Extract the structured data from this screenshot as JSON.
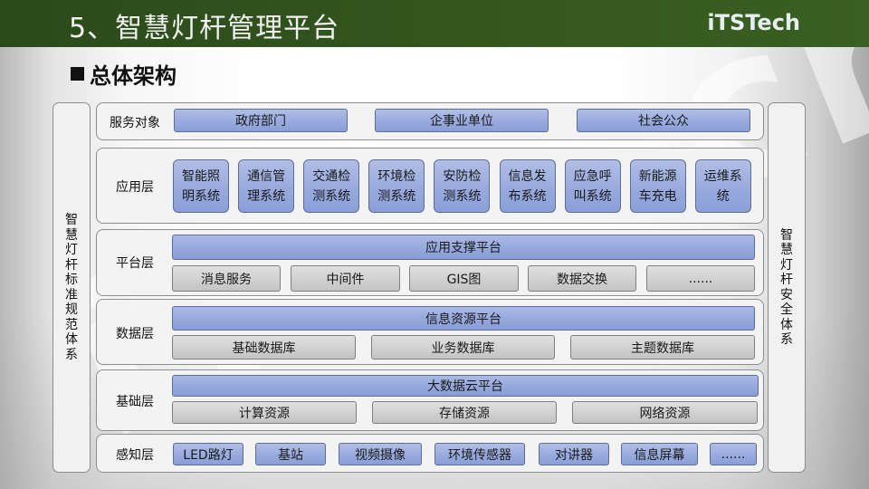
{
  "header": {
    "title": "5、智慧灯杆管理平台",
    "logo": "iTSTech",
    "bar_color": "#33561e"
  },
  "section": {
    "title": "总体架构"
  },
  "watermark": "iTSTech",
  "side_left": {
    "label": "智慧灯杆标准规范体系"
  },
  "side_right": {
    "label": "智慧灯杆安全体系"
  },
  "layers": {
    "service": {
      "label": "服务对象",
      "items": [
        "政府部门",
        "企事业单位",
        "社会公众"
      ]
    },
    "application": {
      "label": "应用层",
      "items": [
        "智能照明系统",
        "通信管理系统",
        "交通检测系统",
        "环境检测系统",
        "安防检测系统",
        "信息发布系统",
        "应急呼叫系统",
        "新能源车充电",
        "运维系统"
      ],
      "lines": [
        [
          "智能照",
          "明系统"
        ],
        [
          "通信管",
          "理系统"
        ],
        [
          "交通检",
          "测系统"
        ],
        [
          "环境检",
          "测系统"
        ],
        [
          "安防检",
          "测系统"
        ],
        [
          "信息发",
          "布系统"
        ],
        [
          "应急呼",
          "叫系统"
        ],
        [
          "新能源",
          "车充电"
        ],
        [
          "运维系",
          "统"
        ]
      ]
    },
    "platform": {
      "label": "平台层",
      "main": "应用支撑平台",
      "items": [
        "消息服务",
        "中间件",
        "GIS图",
        "数据交换",
        "......"
      ]
    },
    "data": {
      "label": "数据层",
      "main": "信息资源平台",
      "items": [
        "基础数据库",
        "业务数据库",
        "主题数据库"
      ]
    },
    "infrastructure": {
      "label": "基础层",
      "main": "大数据云平台",
      "items": [
        "计算资源",
        "存储资源",
        "网络资源"
      ]
    },
    "perception": {
      "label": "感知层",
      "items": [
        "LED路灯",
        "基站",
        "视频摄像",
        "环境传感器",
        "对讲器",
        "信息屏幕",
        "......"
      ]
    }
  },
  "colors": {
    "blue_box": "#98aadd",
    "gray_box": "#cfcfcf",
    "panel": "#f3f3f3"
  }
}
